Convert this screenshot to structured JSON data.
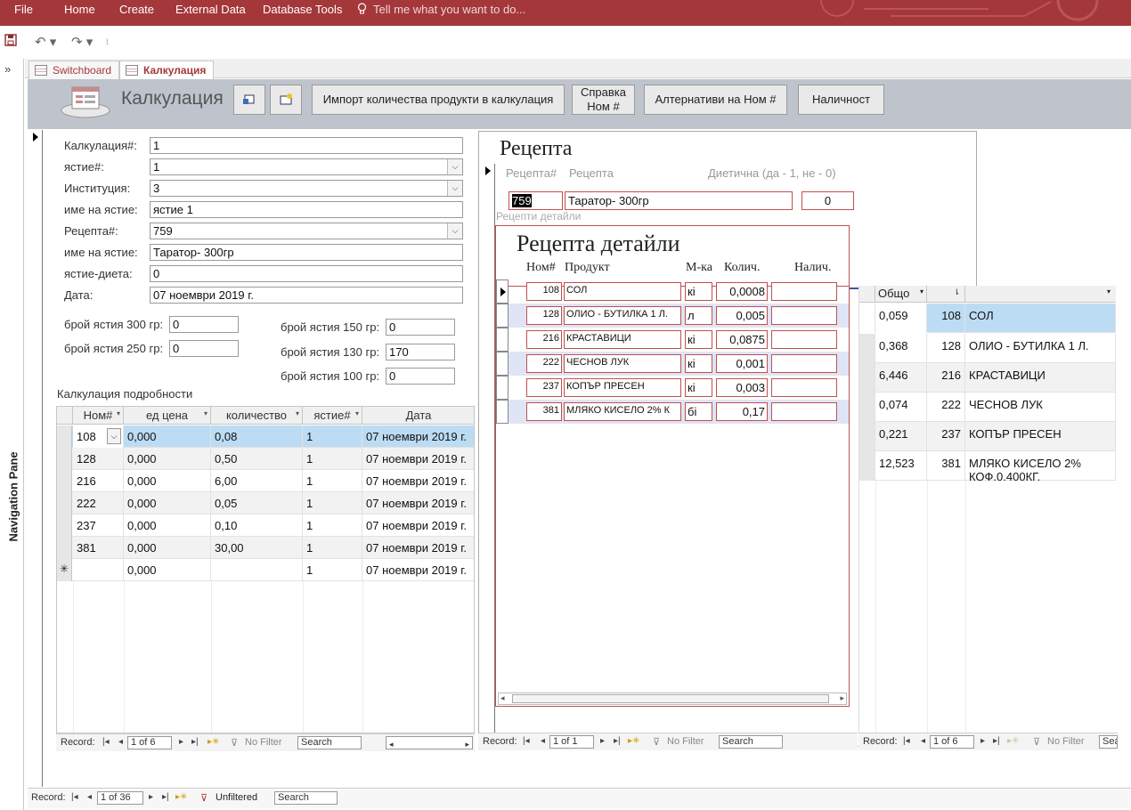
{
  "ribbon": {
    "menu": [
      "File",
      "Home",
      "Create",
      "External Data",
      "Database Tools"
    ],
    "tell_me": "Tell me what you want to do..."
  },
  "nav_pane": {
    "label": "Navigation Pane"
  },
  "tabs": [
    {
      "label": "Switchboard",
      "active": false
    },
    {
      "label": "Калкулация",
      "active": true
    }
  ],
  "form": {
    "title": "Калкулация",
    "buttons": {
      "import": "Импорт количества продукти в калкулация",
      "help_line1": "Справка",
      "help_line2": "Ном #",
      "alternatives": "Алтернативи на Ном #",
      "availability": "Наличност"
    },
    "fields": {
      "calc_no_label": "Калкулация#:",
      "calc_no": "1",
      "dish_no_label": "ястие#:",
      "dish_no": "1",
      "institution_label": "Институция:",
      "institution": "3",
      "dish_name_label": "име на ястие:",
      "dish_name": "ястие 1",
      "recipe_no_label": "Рецепта#:",
      "recipe_no": "759",
      "recipe_name_label": "име на ястие:",
      "recipe_name": "Таратор- 300гр",
      "diet_label": "ястие-диета:",
      "diet": "0",
      "date_label": "Дата:",
      "date": "07 ноември 2019 г."
    },
    "portions": {
      "p300_label": "брой ястия 300 гр:",
      "p300": "0",
      "p250_label": "брой ястия 250 гр:",
      "p250": "0",
      "p150_label": "брой ястия 150 гр:",
      "p150": "0",
      "p130_label": "брой ястия 130 гр:",
      "p130": "170",
      "p100_label": "брой ястия 100 гр:",
      "p100": "0"
    },
    "details_caption": "Калкулация подробности"
  },
  "details_table": {
    "columns": [
      "Ном#",
      "ед цена",
      "количество",
      "ястие#",
      "Дата"
    ],
    "rows": [
      [
        "108",
        "0,000",
        "0,08",
        "1",
        "07 ноември 2019 г."
      ],
      [
        "128",
        "0,000",
        "0,50",
        "1",
        "07 ноември 2019 г."
      ],
      [
        "216",
        "0,000",
        "6,00",
        "1",
        "07 ноември 2019 г."
      ],
      [
        "222",
        "0,000",
        "0,05",
        "1",
        "07 ноември 2019 г."
      ],
      [
        "237",
        "0,000",
        "0,10",
        "1",
        "07 ноември 2019 г."
      ],
      [
        "381",
        "0,000",
        "30,00",
        "1",
        "07 ноември 2019 г."
      ]
    ],
    "new_row": [
      "",
      "0,000",
      "",
      "1",
      "07 ноември 2019 г."
    ],
    "new_marker": "✳",
    "nav": {
      "label": "Record:",
      "position": "1 of 6",
      "filter": "No Filter",
      "search": "Search"
    }
  },
  "recipe": {
    "title": "Рецепта",
    "col_recipe_no": "Рецепта#",
    "col_recipe": "Рецепта",
    "col_diet": "Диетична (да - 1, не - 0)",
    "recipe_no": "759",
    "recipe_name": "Таратор- 300гр",
    "diet": "0",
    "sub_caption": "Рецепти детайли",
    "nav": {
      "label": "Record:",
      "position": "1 of 1",
      "filter": "No Filter",
      "search": "Search"
    }
  },
  "recipe_details": {
    "title": "Рецепта детайли",
    "columns": [
      "Ном#",
      "Продукт",
      "М-ка",
      "Колич.",
      "Налич."
    ],
    "rows": [
      [
        "108",
        "СОЛ",
        "кі",
        "0,0008",
        ""
      ],
      [
        "128",
        "ОЛИО - БУТИЛКА 1 Л.",
        "л",
        "0,005",
        ""
      ],
      [
        "216",
        "КРАСТАВИЦИ",
        "кі",
        "0,0875",
        ""
      ],
      [
        "222",
        "ЧЕСНОВ ЛУК",
        "кі",
        "0,001",
        ""
      ],
      [
        "237",
        "КОПЪР ПРЕСЕН",
        "кі",
        "0,003",
        ""
      ],
      [
        "381",
        "МЛЯКО КИСЕЛО 2% К",
        "бі",
        "0,17",
        ""
      ]
    ]
  },
  "totals_table": {
    "columns": [
      "Общо",
      "",
      ""
    ],
    "rows": [
      [
        "0,059",
        "108",
        "СОЛ"
      ],
      [
        "0,368",
        "128",
        "ОЛИО - БУТИЛКА 1 Л."
      ],
      [
        "6,446",
        "216",
        "КРАСТАВИЦИ"
      ],
      [
        "0,074",
        "222",
        "ЧЕСНОВ ЛУК"
      ],
      [
        "0,221",
        "237",
        "КОПЪР ПРЕСЕН"
      ],
      [
        "12,523",
        "381",
        "МЛЯКО КИСЕЛО 2% КОФ.0,400КГ."
      ]
    ],
    "nav": {
      "label": "Record:",
      "position": "1 of 6",
      "filter": "No Filter",
      "search": "Sea"
    }
  },
  "main_nav": {
    "label": "Record:",
    "position": "1 of 36",
    "filter": "Unfiltered",
    "search": "Search"
  },
  "colors": {
    "ribbon": "#a4373a",
    "header": "#bfc4cc",
    "highlight": "#bcdcf4",
    "accent_border": "#c0504d"
  }
}
